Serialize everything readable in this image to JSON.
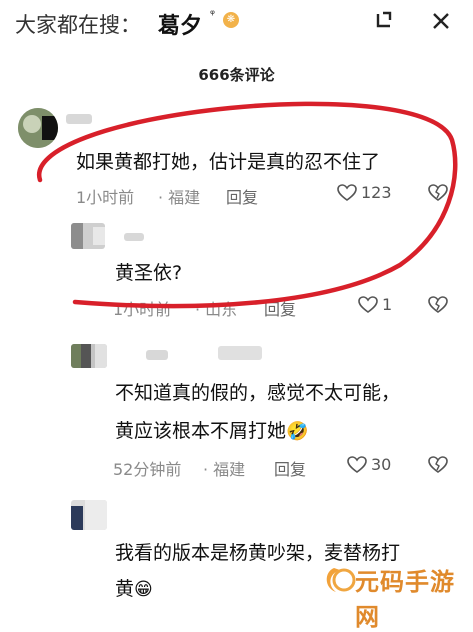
{
  "topbar": {
    "prefix": "大家都在搜：",
    "query": "葛夕",
    "search_glyph": "ᵠ",
    "badge_icon": "fire-badge-icon"
  },
  "count_title": "666条评论",
  "comments": [
    {
      "text": "如果黄都打她，估计是真的忍不住了",
      "time": "1小时前",
      "location": "· 福建",
      "reply": "回复",
      "likes": "123"
    },
    {
      "text": "黄圣依?",
      "time": "1小时前",
      "location": "· 山东",
      "reply": "回复",
      "likes": "1"
    },
    {
      "text_line1": "不知道真的假的，感觉不太可能，",
      "text_line2": "黄应该根本不屑打她",
      "time": "52分钟前",
      "location": "· 福建",
      "reply": "回复",
      "likes": "30"
    },
    {
      "text_line1": "我看的版本是杨黄吵架，麦替杨打",
      "text_line2": "黄"
    }
  ],
  "watermark": {
    "text": "元码手游网"
  },
  "colors": {
    "annotation_red": "#d8202a",
    "meta_gray": "#8a8a8a",
    "watermark_orange": "#e08a2c"
  }
}
